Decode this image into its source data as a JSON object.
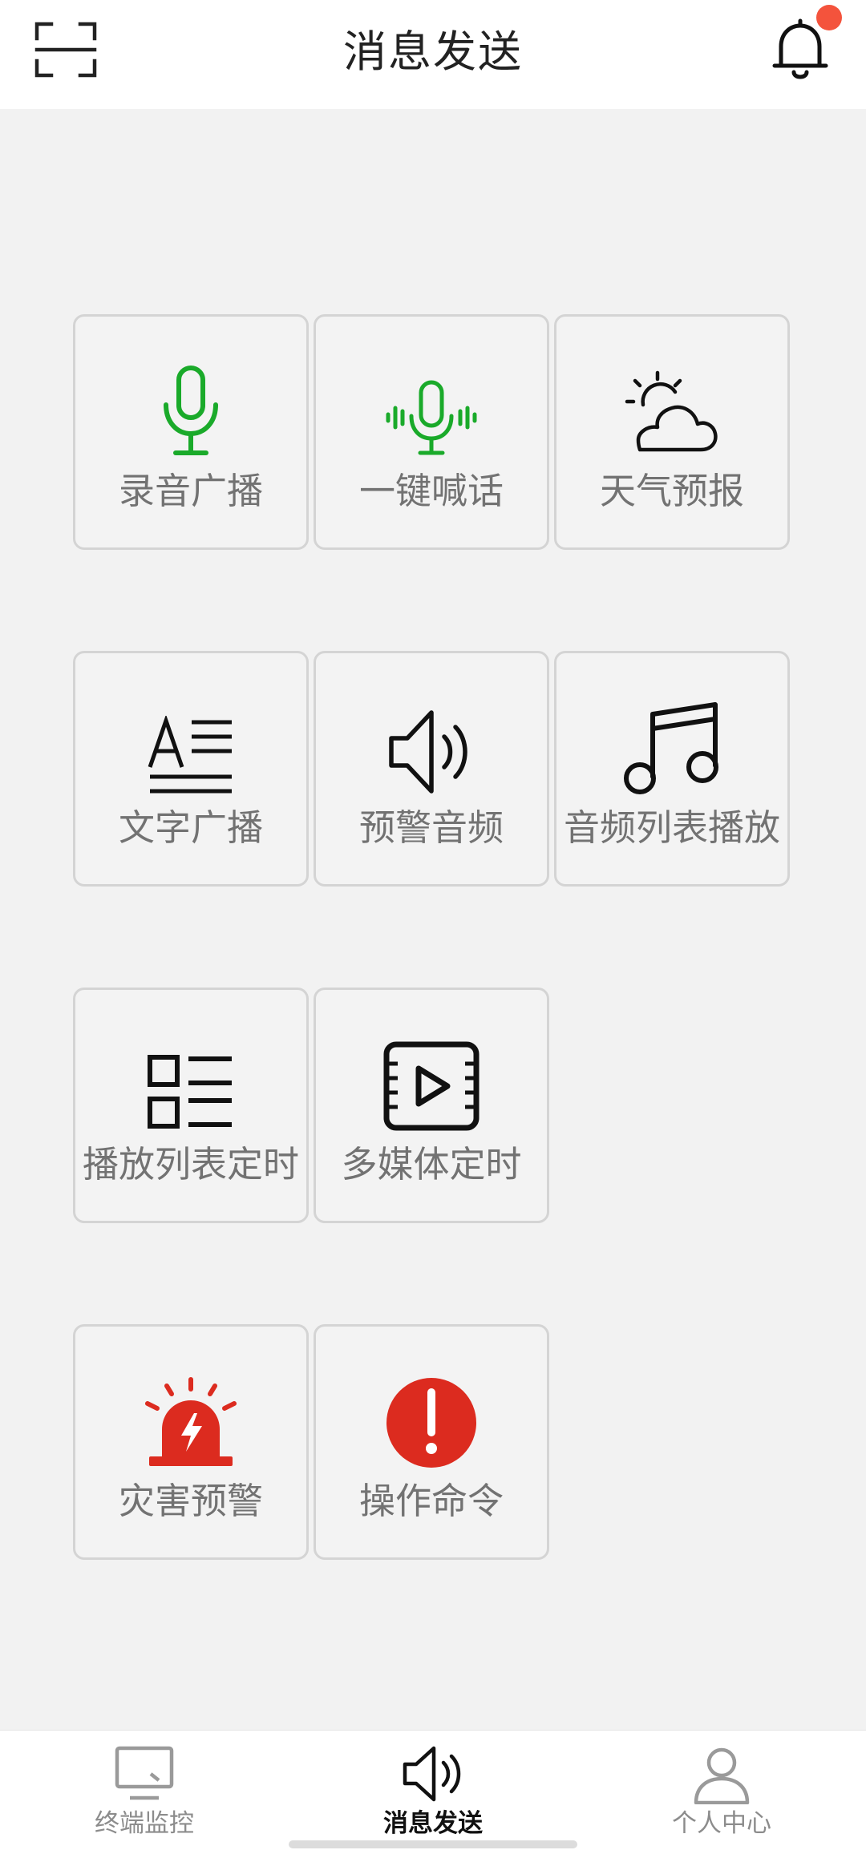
{
  "header": {
    "title": "消息发送",
    "scan_icon": "scan-icon",
    "bell_icon": "bell-icon",
    "badge_color": "#f4533c"
  },
  "tiles": [
    {
      "label": "录音广播",
      "icon": "microphone-icon",
      "color": "#1aaa2a"
    },
    {
      "label": "一键喊话",
      "icon": "voice-wave-icon",
      "color": "#1aaa2a"
    },
    {
      "label": "天气预报",
      "icon": "weather-icon",
      "color": "#111111"
    },
    {
      "label": "文字广播",
      "icon": "text-icon",
      "color": "#111111"
    },
    {
      "label": "预警音频",
      "icon": "speaker-icon",
      "color": "#111111"
    },
    {
      "label": "音频列表播放",
      "icon": "music-note-icon",
      "color": "#111111"
    },
    {
      "label": "播放列表定时",
      "icon": "list-icon",
      "color": "#111111"
    },
    {
      "label": "多媒体定时",
      "icon": "video-icon",
      "color": "#111111"
    },
    {
      "label": "灾害预警",
      "icon": "alarm-siren-icon",
      "color": "#dc2b1f"
    },
    {
      "label": "操作命令",
      "icon": "exclamation-icon",
      "color": "#dc2b1f"
    }
  ],
  "tabs": [
    {
      "label": "终端监控",
      "icon": "monitor-icon",
      "active": false
    },
    {
      "label": "消息发送",
      "icon": "speaker-icon",
      "active": true
    },
    {
      "label": "个人中心",
      "icon": "person-icon",
      "active": false
    }
  ]
}
